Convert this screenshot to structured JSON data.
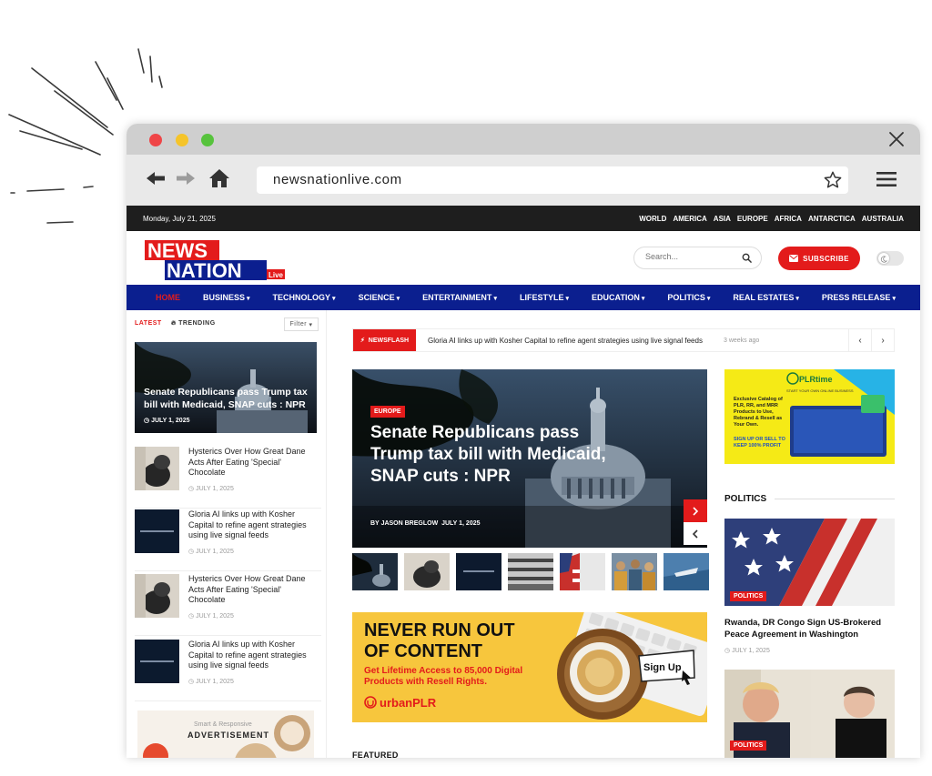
{
  "browser": {
    "url": "newsnationlive.com"
  },
  "site": {
    "date": "Monday, July 21, 2025",
    "regions": [
      "WORLD",
      "AMERICA",
      "ASIA",
      "EUROPE",
      "AFRICA",
      "ANTARCTICA",
      "AUSTRALIA"
    ],
    "logo": {
      "line1": "NEWS",
      "line2": "NATION",
      "badge": "Live"
    },
    "search_placeholder": "Search...",
    "subscribe_label": "SUBSCRIBE",
    "nav": [
      {
        "label": "HOME",
        "has_menu": false
      },
      {
        "label": "BUSINESS",
        "has_menu": true
      },
      {
        "label": "TECHNOLOGY",
        "has_menu": true
      },
      {
        "label": "SCIENCE",
        "has_menu": true
      },
      {
        "label": "ENTERTAINMENT",
        "has_menu": true
      },
      {
        "label": "LIFESTYLE",
        "has_menu": true
      },
      {
        "label": "EDUCATION",
        "has_menu": true
      },
      {
        "label": "POLITICS",
        "has_menu": true
      },
      {
        "label": "REAL ESTATES",
        "has_menu": true
      },
      {
        "label": "PRESS RELEASE",
        "has_menu": true
      }
    ]
  },
  "sidebar": {
    "tab_latest": "LATEST",
    "tab_trending": "TRENDING",
    "filter_label": "Filter",
    "hero": {
      "title": "Senate Republicans pass Trump tax bill with Medicaid, SNAP cuts : NPR",
      "date": "JULY 1, 2025"
    },
    "items": [
      {
        "title": "Hysterics Over How Great Dane Acts After Eating 'Special' Chocolate",
        "date": "JULY 1, 2025",
        "thumb": "dog"
      },
      {
        "title": "Gloria AI links up with Kosher Capital to refine agent strategies using live signal feeds",
        "date": "JULY 1, 2025",
        "thumb": "dark"
      },
      {
        "title": "Hysterics Over How Great Dane Acts After Eating 'Special' Chocolate",
        "date": "JULY 1, 2025",
        "thumb": "dog"
      },
      {
        "title": "Gloria AI links up with Kosher Capital to refine agent strategies using live signal feeds",
        "date": "JULY 1, 2025",
        "thumb": "dark"
      }
    ],
    "ad": {
      "small": "Smart & Responsive",
      "big": "ADVERTISEMENT"
    }
  },
  "main": {
    "newsflash_label": "NEWSFLASH",
    "newsflash_text": "Gloria AI links up with Kosher Capital to refine agent strategies using live signal feeds",
    "newsflash_ago": "3 weeks ago",
    "hero": {
      "category": "EUROPE",
      "title": "Senate Republicans pass Trump tax bill with Medicaid, SNAP cuts : NPR",
      "byline_prefix": "BY",
      "author": "JASON BREGLOW",
      "date": "JULY 1, 2025"
    },
    "thumbs": [
      "capitol",
      "dog",
      "dark",
      "building",
      "flag",
      "crowd",
      "boat"
    ],
    "ad": {
      "headline": "NEVER RUN OUT OF CONTENT",
      "sub": "Get Lifetime Access to 85,000 Digital Products with Resell Rights.",
      "brand": "urbanPLR",
      "cta": "Sign Up"
    },
    "featured_label": "FEATURED"
  },
  "right": {
    "ad": {
      "brand": "PLRtime",
      "tag": "START YOUR OWN ONLINE BUSINESS",
      "body": "Exclusive Catalog of PLR, RR, and MRR Products to Use, Rebrand & Resell as Your Own.",
      "cta": "SIGN UP OR SELL TO KEEP 100% PROFIT"
    },
    "section": "POLITICS",
    "articles": [
      {
        "category": "POLITICS",
        "title": "Rwanda, DR Congo Sign US-Brokered Peace Agreement in Washington",
        "date": "JULY 1, 2025"
      },
      {
        "category": "POLITICS"
      }
    ]
  },
  "colors": {
    "brand_red": "#e31b1b",
    "nav_blue": "#0b1f8f",
    "topbar": "#1e1e1e",
    "ad_yellow": "#f7c63d"
  }
}
